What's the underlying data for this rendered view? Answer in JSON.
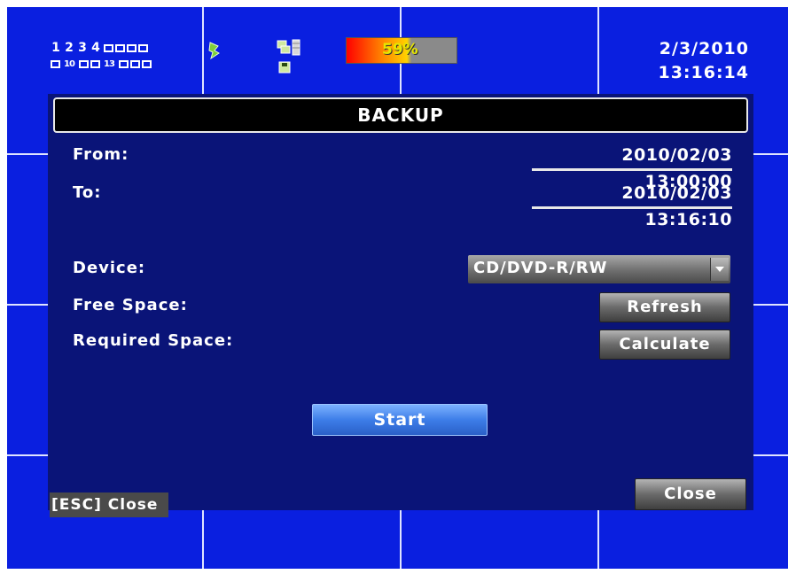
{
  "status_bar": {
    "channels_row1": [
      "1",
      "2",
      "3",
      "4"
    ],
    "channels_row2": [
      "10",
      "13"
    ],
    "hdd_usage": "59%",
    "hdd_usage_fraction": 0.59,
    "date": "2/3/2010",
    "time": "13:16:14"
  },
  "dialog": {
    "title": "BACKUP",
    "from_label": "From:",
    "from_value": "2010/02/03 13:00:00",
    "to_label": "To:",
    "to_value": "2010/02/03 13:16:10",
    "device_label": "Device:",
    "device_value": "CD/DVD-R/RW",
    "free_space_label": "Free Space:",
    "refresh_button": "Refresh",
    "required_space_label": "Required Space:",
    "calculate_button": "Calculate",
    "start_button": "Start",
    "esc_hint": "[ESC] Close",
    "close_button": "Close"
  },
  "colors": {
    "background": "#0a1fe0",
    "dialog": "#0a1478",
    "start_button": "#3d7de8"
  },
  "icons": [
    "record-icon",
    "network-icon",
    "disk-icon",
    "dropdown-arrow-icon"
  ]
}
